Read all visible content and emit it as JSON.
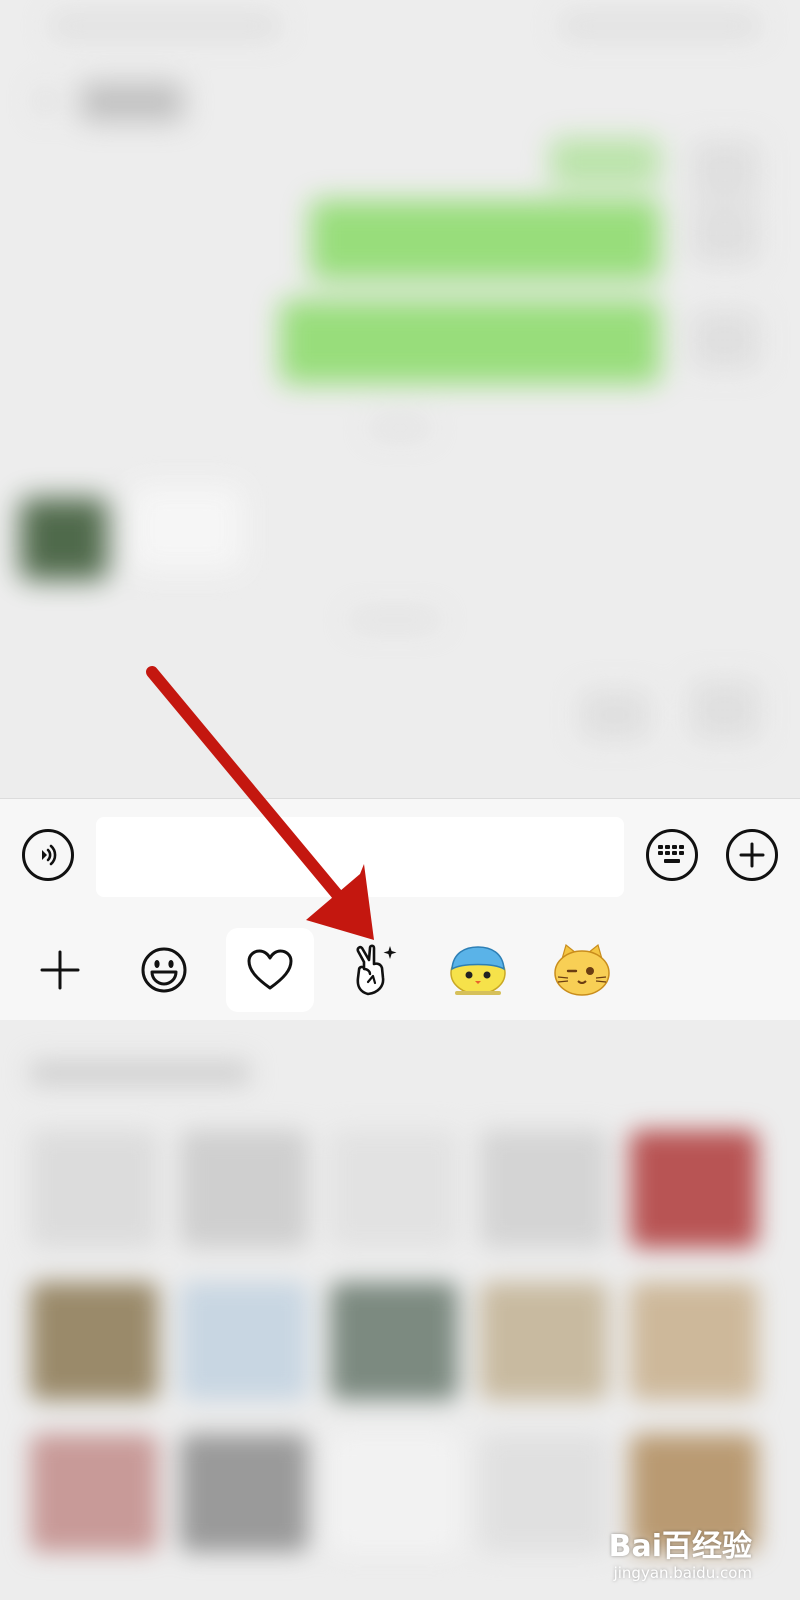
{
  "input_bar": {
    "voice_icon": "voice-wave-icon",
    "message_value": "",
    "keyboard_icon": "keyboard-icon",
    "more_icon": "plus-circle-icon"
  },
  "sticker_tabs": [
    {
      "icon": "plus-icon",
      "selected": false
    },
    {
      "icon": "smiley-icon",
      "selected": false
    },
    {
      "icon": "heart-icon",
      "selected": true
    },
    {
      "icon": "peace-hand-sparkle-icon",
      "selected": false
    },
    {
      "icon": "blue-hat-cat-sticker-icon",
      "selected": false
    },
    {
      "icon": "winking-cat-sticker-icon",
      "selected": false
    }
  ],
  "annotation": {
    "arrow_color": "#c4170f",
    "points_to": "peace-hand-sparkle-icon"
  },
  "colors": {
    "chat_background": "#ededed",
    "panel_background": "#f7f7f7",
    "sent_bubble": "#8fdc6f",
    "selected_tab": "#ffffff"
  },
  "watermark": {
    "brand": "Bai百经验",
    "url": "jingyan.baidu.com"
  }
}
